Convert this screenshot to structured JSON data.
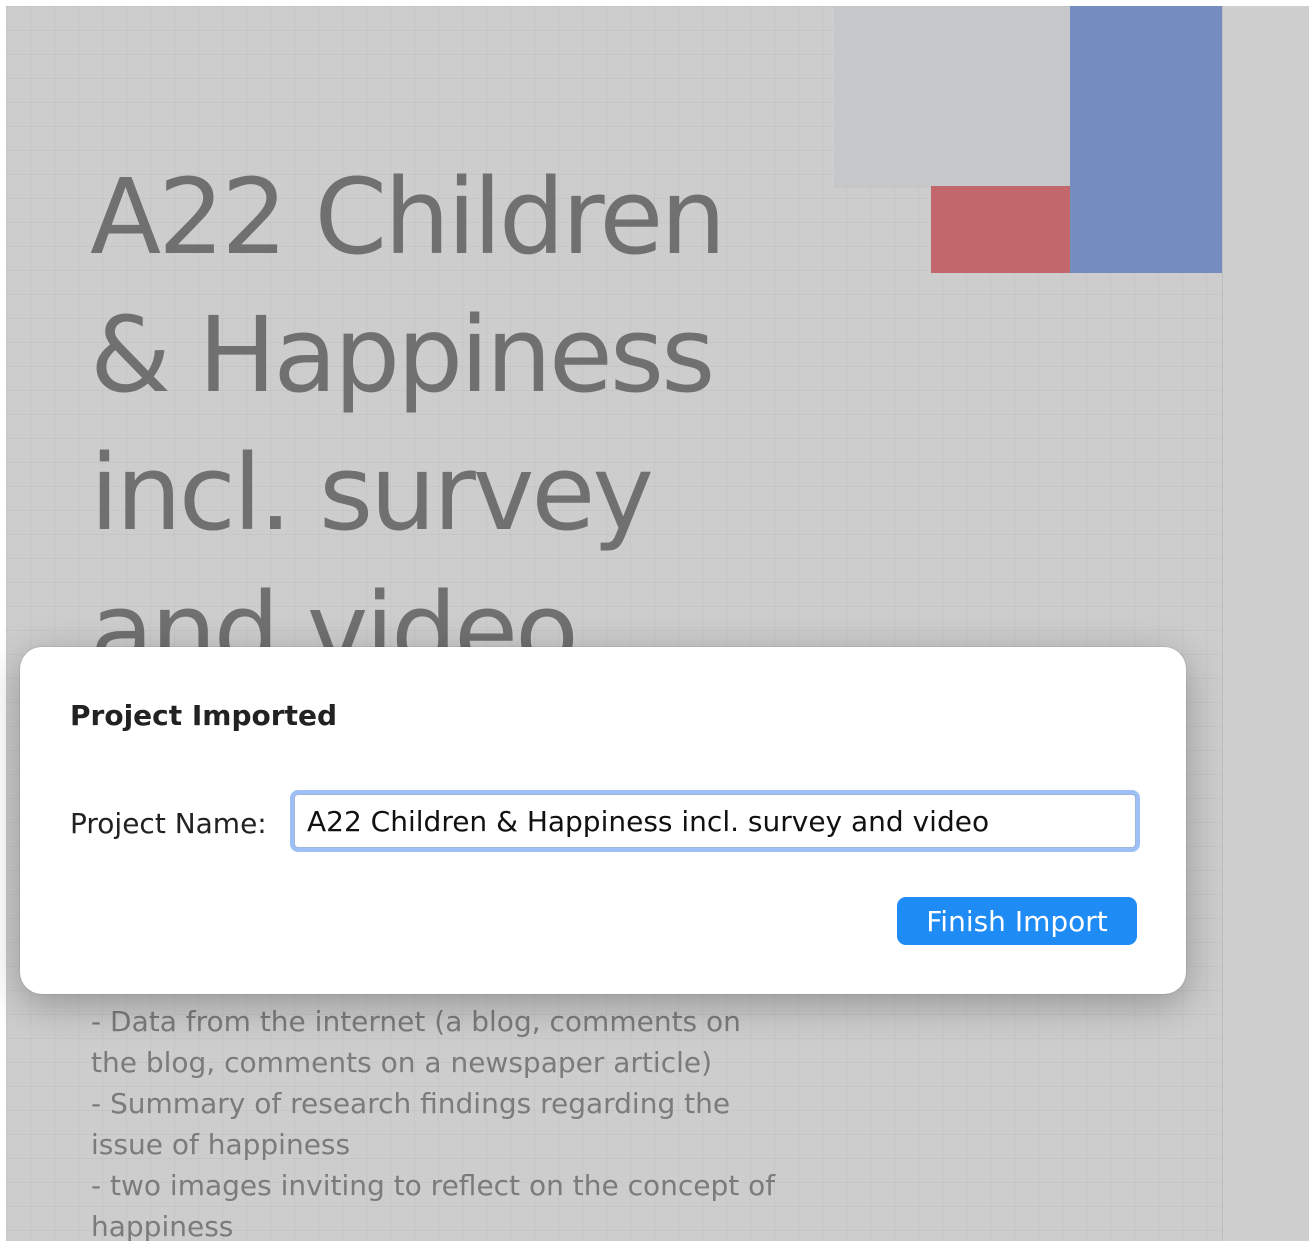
{
  "document": {
    "title_lines": [
      "A22 Children",
      "& Happiness",
      "incl. survey",
      "and video"
    ],
    "bullets": [
      "- Data from the internet (a blog, comments on",
      "the blog, comments on a newspaper article)",
      "- Summary of research findings regarding the",
      "issue of happiness",
      "- two images inviting to reflect on the concept of",
      "happiness"
    ],
    "colors": {
      "accent_red": "#c2676b",
      "accent_blue": "#748cc0",
      "accent_gray": "#c6c7c9"
    }
  },
  "dialog": {
    "title": "Project Imported",
    "field_label": "Project Name:",
    "project_name_value": "A22 Children & Happiness incl. survey and video",
    "finish_button_label": "Finish Import",
    "colors": {
      "button": "#1f8bf5",
      "focus_ring": "#508cf0"
    }
  }
}
